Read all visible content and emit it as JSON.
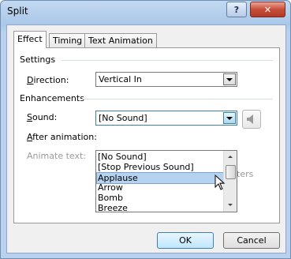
{
  "window": {
    "title": "Split",
    "help_label": "?",
    "close_label": "✕"
  },
  "tabs": [
    {
      "label": "Effect",
      "active": true
    },
    {
      "label": "Timing",
      "active": false
    },
    {
      "label": "Text Animation",
      "active": false
    }
  ],
  "settings": {
    "heading": "Settings",
    "direction_label": "Direction:",
    "direction_value": "Vertical In"
  },
  "enhancements": {
    "heading": "Enhancements",
    "sound_label": "Sound:",
    "sound_value": "[No Sound]",
    "after_animation_label": "After animation:",
    "animate_text_label": "Animate text:",
    "obscured_suffix": "ters"
  },
  "sound_options": [
    "[No Sound]",
    "[Stop Previous Sound]",
    "Applause",
    "Arrow",
    "Bomb",
    "Breeze"
  ],
  "selected_sound_index": 2,
  "buttons": {
    "ok": "OK",
    "cancel": "Cancel"
  },
  "icons": {
    "speaker": "speaker-icon",
    "cursor": "mouse-pointer-icon"
  }
}
